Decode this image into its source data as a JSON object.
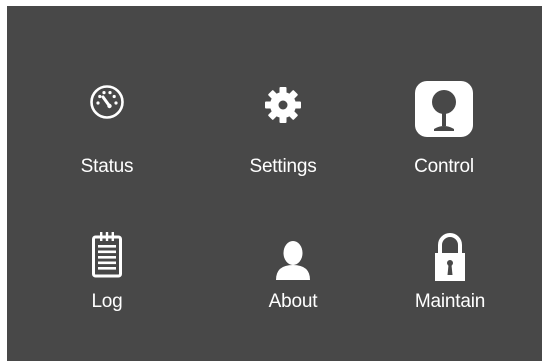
{
  "menu": {
    "items": [
      {
        "label": "Status",
        "icon": "speedometer-icon"
      },
      {
        "label": "Settings",
        "icon": "gear-icon"
      },
      {
        "label": "Control",
        "icon": "joystick-icon"
      },
      {
        "label": "Log",
        "icon": "notepad-icon"
      },
      {
        "label": "About",
        "icon": "person-icon"
      },
      {
        "label": "Maintain",
        "icon": "padlock-icon"
      }
    ]
  },
  "colors": {
    "panel_background": "#484848",
    "page_background": "#ffffff",
    "foreground": "#ffffff"
  }
}
